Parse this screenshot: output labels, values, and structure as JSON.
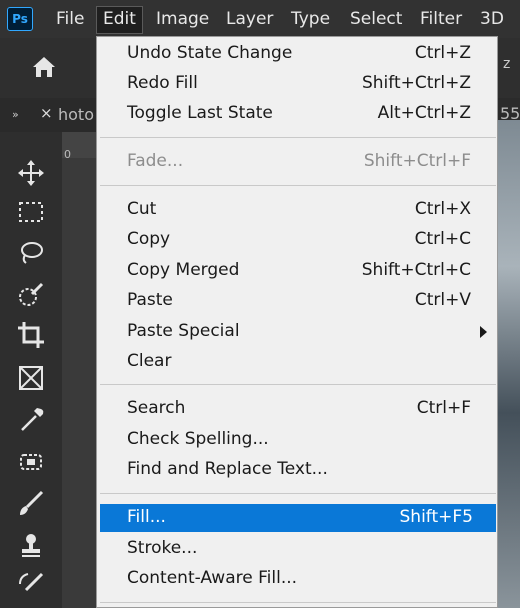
{
  "app": {
    "logo_text": "Ps"
  },
  "menubar": {
    "items": [
      "File",
      "Edit",
      "Image",
      "Layer",
      "Type",
      "Select",
      "Filter",
      "3D"
    ],
    "active": "Edit"
  },
  "options_bar": {
    "right_fragment": "z"
  },
  "tab": {
    "chevron": "»",
    "close": "×",
    "title_fragment": "hoto",
    "right_fragment": "55"
  },
  "ruler": {
    "mark": "0"
  },
  "edit_menu": {
    "items": [
      {
        "label": "Undo State Change",
        "shortcut": "Ctrl+Z"
      },
      {
        "label": "Redo Fill",
        "shortcut": "Shift+Ctrl+Z"
      },
      {
        "label": "Toggle Last State",
        "shortcut": "Alt+Ctrl+Z"
      },
      {
        "label": "Fade...",
        "shortcut": "Shift+Ctrl+F",
        "disabled": true
      },
      {
        "label": "Cut",
        "shortcut": "Ctrl+X"
      },
      {
        "label": "Copy",
        "shortcut": "Ctrl+C"
      },
      {
        "label": "Copy Merged",
        "shortcut": "Shift+Ctrl+C"
      },
      {
        "label": "Paste",
        "shortcut": "Ctrl+V"
      },
      {
        "label": "Paste Special",
        "shortcut": "",
        "submenu": true
      },
      {
        "label": "Clear",
        "shortcut": ""
      },
      {
        "label": "Search",
        "shortcut": "Ctrl+F"
      },
      {
        "label": "Check Spelling...",
        "shortcut": ""
      },
      {
        "label": "Find and Replace Text...",
        "shortcut": ""
      },
      {
        "label": "Fill...",
        "shortcut": "Shift+F5",
        "highlighted": true
      },
      {
        "label": "Stroke...",
        "shortcut": ""
      },
      {
        "label": "Content-Aware Fill...",
        "shortcut": ""
      }
    ]
  },
  "colors": {
    "highlight": "#0a78d7",
    "menu_bg": "#f0f0f0",
    "ps_blue": "#31a8ff"
  },
  "toolbar": {
    "tools": [
      "move-tool-icon",
      "marquee-tool-icon",
      "lasso-tool-icon",
      "quick-selection-tool-icon",
      "crop-tool-icon",
      "frame-tool-icon",
      "eyedropper-tool-icon",
      "spot-healing-tool-icon",
      "brush-tool-icon",
      "clone-stamp-tool-icon",
      "history-brush-tool-icon"
    ]
  }
}
